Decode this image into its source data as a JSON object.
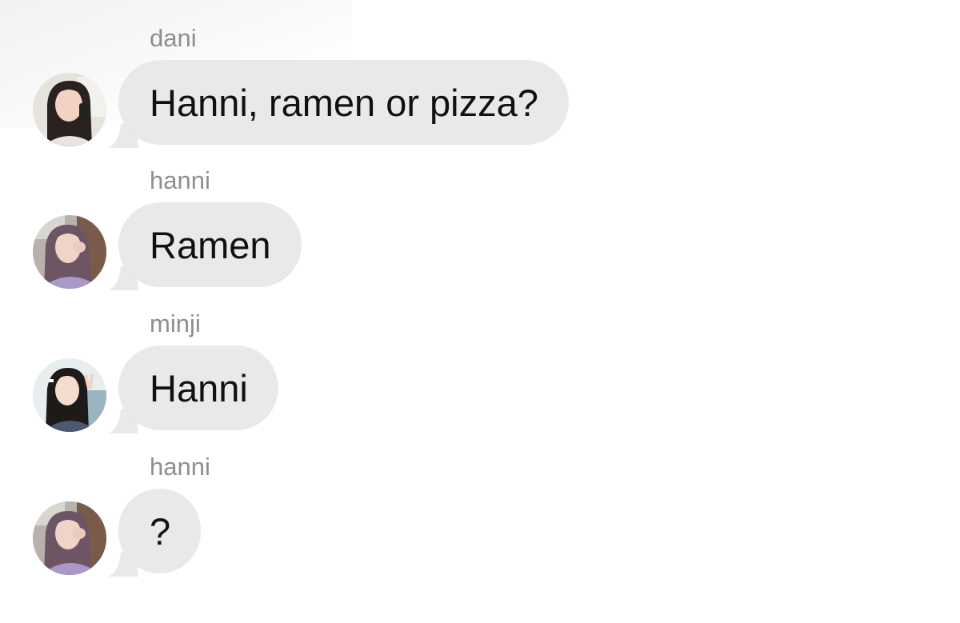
{
  "messages": [
    {
      "sender": "dani",
      "text": "Hanni, ramen or pizza?",
      "avatar": "avatar-dani"
    },
    {
      "sender": "hanni",
      "text": "Ramen",
      "avatar": "avatar-hanni"
    },
    {
      "sender": "minji",
      "text": "Hanni",
      "avatar": "avatar-minji"
    },
    {
      "sender": "hanni",
      "text": "?",
      "avatar": "avatar-hanni"
    }
  ],
  "colors": {
    "bubble": "#e9e9eb",
    "sender_name": "#8e8e93",
    "message_text": "#111111",
    "background": "#ffffff"
  }
}
